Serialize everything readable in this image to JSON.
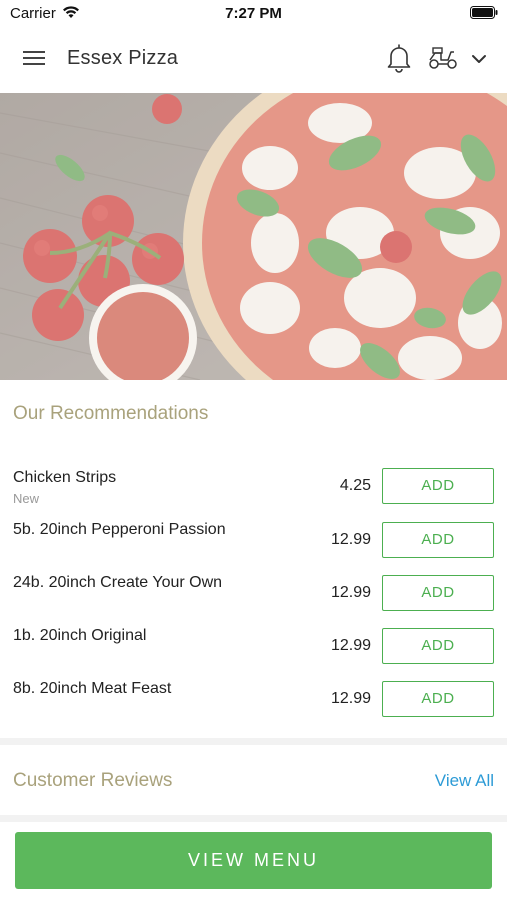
{
  "status_bar": {
    "carrier": "Carrier",
    "time": "7:27 PM"
  },
  "header": {
    "title": "Essex Pizza",
    "icons": [
      "menu-icon",
      "bell-icon",
      "scooter-icon",
      "chevron-down-icon"
    ]
  },
  "hero": {
    "description_icon": "pizza-hero-image"
  },
  "recommendations": {
    "title": "Our Recommendations",
    "add_label": "ADD",
    "items": [
      {
        "name": "Chicken Strips",
        "tag": "New",
        "price": "4.25"
      },
      {
        "name": "5b. 20inch Pepperoni Passion",
        "tag": "",
        "price": "12.99"
      },
      {
        "name": "24b. 20inch Create Your Own",
        "tag": "",
        "price": "12.99"
      },
      {
        "name": "1b. 20inch Original",
        "tag": "",
        "price": "12.99"
      },
      {
        "name": "8b. 20inch Meat Feast",
        "tag": "",
        "price": "12.99"
      }
    ]
  },
  "reviews": {
    "title": "Customer Reviews",
    "view_all": "View All"
  },
  "footer": {
    "button_label": "VIEW MENU"
  },
  "colors": {
    "accent_green": "#5cb85c",
    "section_title": "#a9a27c",
    "link_blue": "#2d9bd6"
  }
}
